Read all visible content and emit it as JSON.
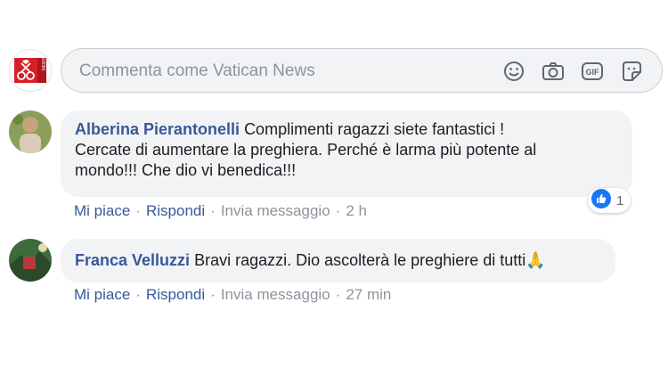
{
  "composer": {
    "placeholder": "Commenta come Vatican News",
    "page_avatar_label": "NEWS",
    "icons": [
      "emoji-icon",
      "camera-icon",
      "gif-icon",
      "sticker-icon"
    ],
    "gif_label": "GIF"
  },
  "comments": [
    {
      "author": "Alberina Pierantonelli",
      "text_lines": [
        "Complimenti ragazzi siete fantastici !",
        "Cercate di aumentare la preghiera. Perché è larma più potente al",
        "mondo!!! Che dio vi benedica!!!"
      ],
      "actions": {
        "like": "Mi piace",
        "reply": "Rispondi",
        "message": "Invia messaggio",
        "time": "2 h"
      },
      "reactions": {
        "icon": "like-icon",
        "count": "1"
      }
    },
    {
      "author": "Franca Velluzzi",
      "text": "Bravi ragazzi. Dio ascolterà le preghiere di tutti",
      "emoji": "🙏",
      "actions": {
        "like": "Mi piace",
        "reply": "Rispondi",
        "message": "Invia messaggio",
        "time": "27 min"
      }
    }
  ],
  "colors": {
    "author": "#385898",
    "bubble": "#f2f3f5",
    "like_blue": "#1877f2",
    "brand_red": "#d62027"
  }
}
